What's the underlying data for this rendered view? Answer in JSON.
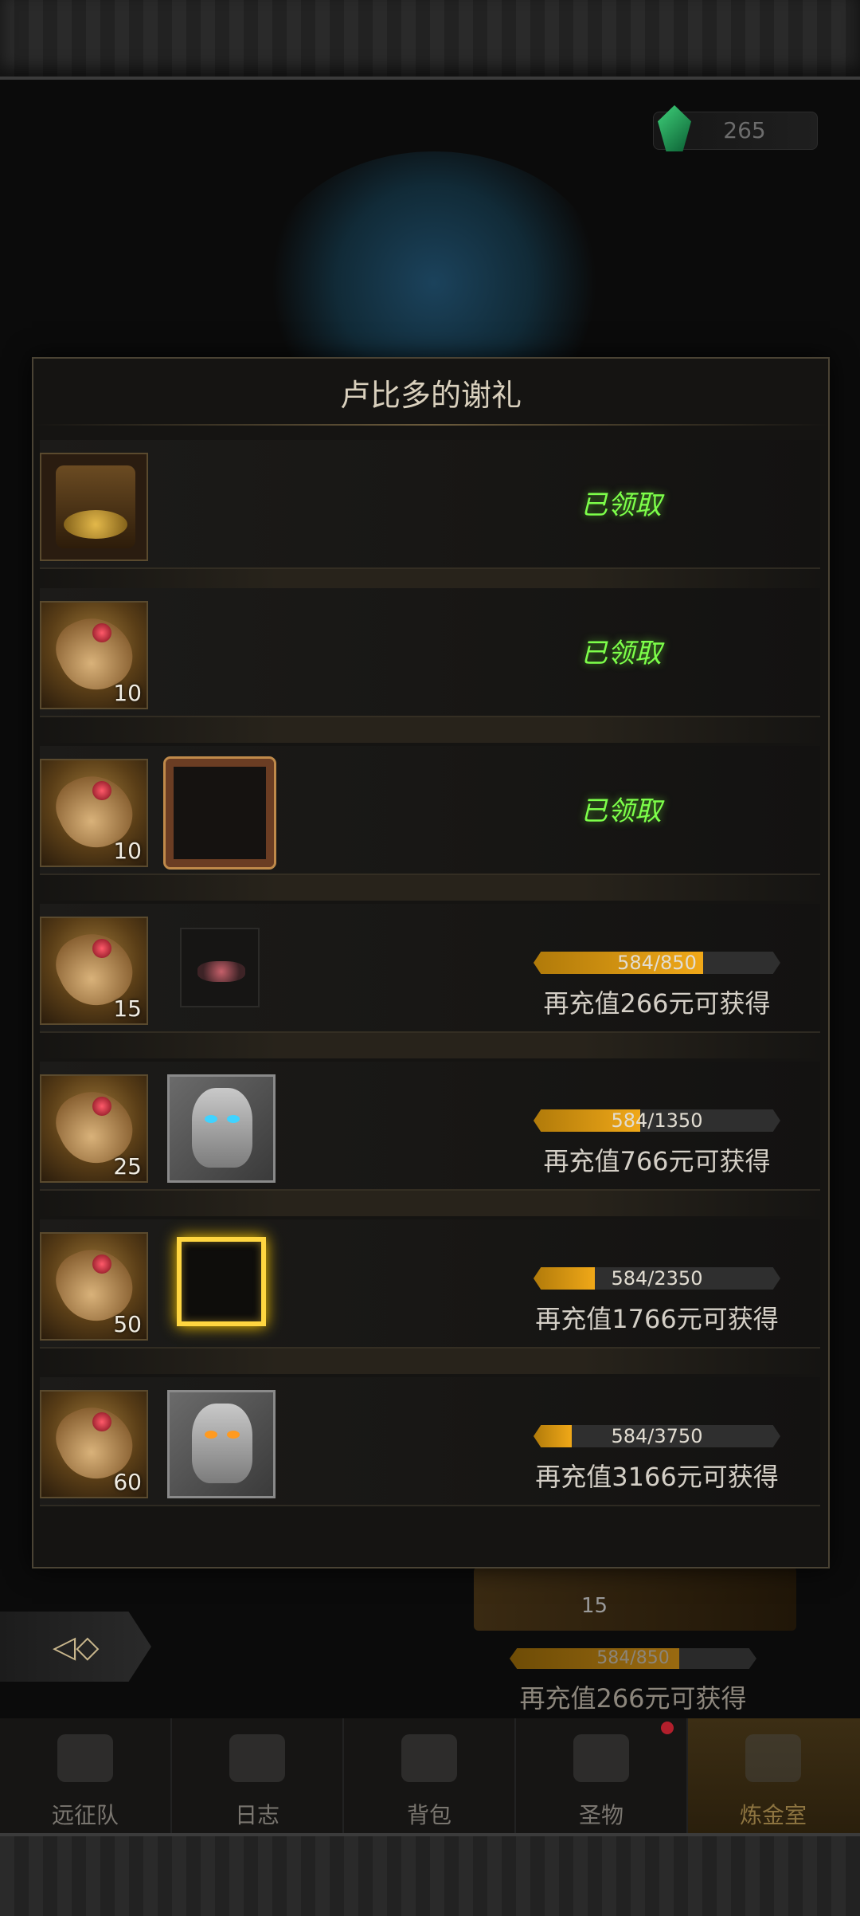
{
  "currency": {
    "value": "265",
    "icon": "green-gem-icon"
  },
  "dialog": {
    "title": "卢比多的谢礼",
    "rows": [
      {
        "reward": {
          "icon": "treasure-chest-icon",
          "count": ""
        },
        "extra": null,
        "status": "已领取"
      },
      {
        "reward": {
          "icon": "scroll-icon",
          "count": "10"
        },
        "extra": null,
        "status": "已领取"
      },
      {
        "reward": {
          "icon": "scroll-icon",
          "count": "10"
        },
        "extra": "ornate-frame-icon",
        "status": "已领取"
      },
      {
        "reward": {
          "icon": "scroll-icon",
          "count": "15"
        },
        "extra": "thorn-crown-icon",
        "progress_text": "584/850",
        "progress": 0.687,
        "hint": "再充值266元可获得"
      },
      {
        "reward": {
          "icon": "scroll-icon",
          "count": "25"
        },
        "extra": "helmet-icon",
        "progress_text": "584/1350",
        "progress": 0.433,
        "hint": "再充值766元可获得"
      },
      {
        "reward": {
          "icon": "scroll-icon",
          "count": "50"
        },
        "extra": "gold-frame-icon",
        "progress_text": "584/2350",
        "progress": 0.249,
        "hint": "再充值1766元可获得"
      },
      {
        "reward": {
          "icon": "scroll-icon",
          "count": "60"
        },
        "extra": "helmet-ii-icon",
        "progress_text": "584/3750",
        "progress": 0.156,
        "hint": "再充值3166元可获得"
      }
    ]
  },
  "background": {
    "reward_count": "15",
    "progress_text": "584/850",
    "progress": 0.687,
    "hint": "再充值266元可获得"
  },
  "nav": {
    "items": [
      {
        "label": "远征队",
        "icon": "viking-helmet-icon"
      },
      {
        "label": "日志",
        "icon": "journal-icon"
      },
      {
        "label": "背包",
        "icon": "backpack-icon"
      },
      {
        "label": "圣物",
        "icon": "relic-icon"
      },
      {
        "label": "炼金室",
        "icon": "alchemy-icon",
        "active": true
      }
    ]
  },
  "colors": {
    "claimed": "#7dff4a",
    "progress_fill": "#f0a818",
    "accent_gold": "#ffd640",
    "notification": "#b21f2c"
  }
}
